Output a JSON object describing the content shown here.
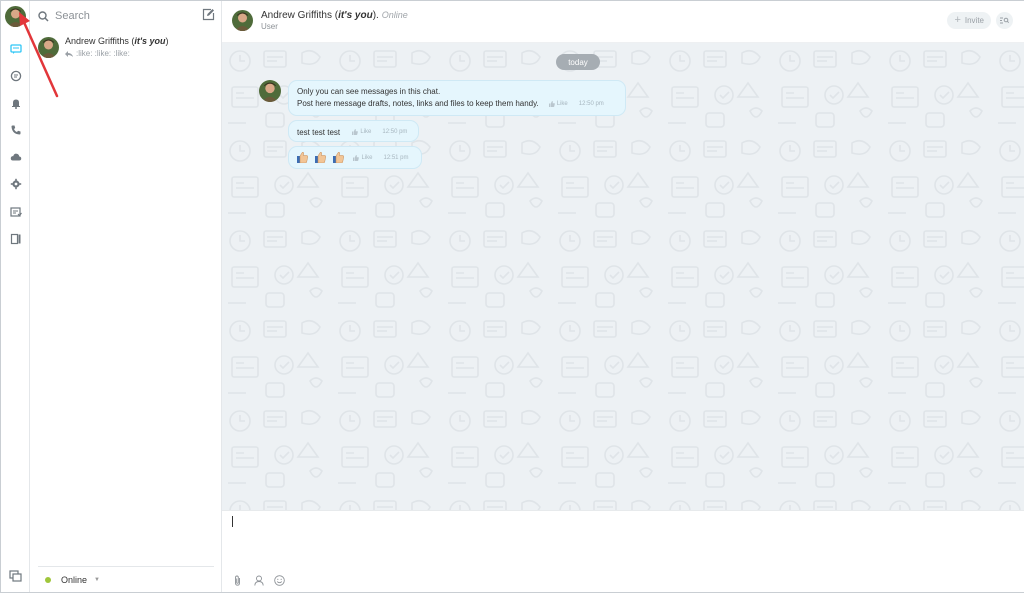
{
  "rail": {
    "items": [
      {
        "name": "chats-icon",
        "active": true
      },
      {
        "name": "open-lines-icon"
      },
      {
        "name": "notifications-icon"
      },
      {
        "name": "call-icon"
      },
      {
        "name": "disk-icon"
      },
      {
        "name": "settings-icon"
      },
      {
        "name": "tasks-icon"
      },
      {
        "name": "docs-icon"
      }
    ],
    "bottom": {
      "name": "unread-icon"
    }
  },
  "sidebar": {
    "search_placeholder": "Search",
    "recent": [
      {
        "name": "Andrew Griffiths",
        "name_suffix_prefix": "(",
        "self_label": "it's you",
        "name_suffix_end": ")",
        "preview": ":like: :like: :like:"
      }
    ],
    "status": {
      "label": "Online",
      "color": "#9fc63b"
    }
  },
  "header": {
    "name": "Andrew Griffiths",
    "paren_open": "(",
    "self_label": "it's you",
    "paren_close": ").",
    "status": "Online",
    "role": "User",
    "invite_label": "Invite"
  },
  "messages": {
    "date_label": "today",
    "items": [
      {
        "lines": [
          "Only you can see messages in this chat.",
          "Post here message drafts, notes, links and files to keep them handy."
        ],
        "like": "Like",
        "time": "12:50 pm"
      },
      {
        "text": "test test test",
        "like": "Like",
        "time": "12:50 pm"
      },
      {
        "emoji_count": 3,
        "like": "Like",
        "time": "12:51 pm"
      }
    ]
  },
  "colors": {
    "accent": "#2fc6f6",
    "bubble": "#e5f6fd",
    "annotation": "#e2363a",
    "background": "#edf1f4"
  }
}
